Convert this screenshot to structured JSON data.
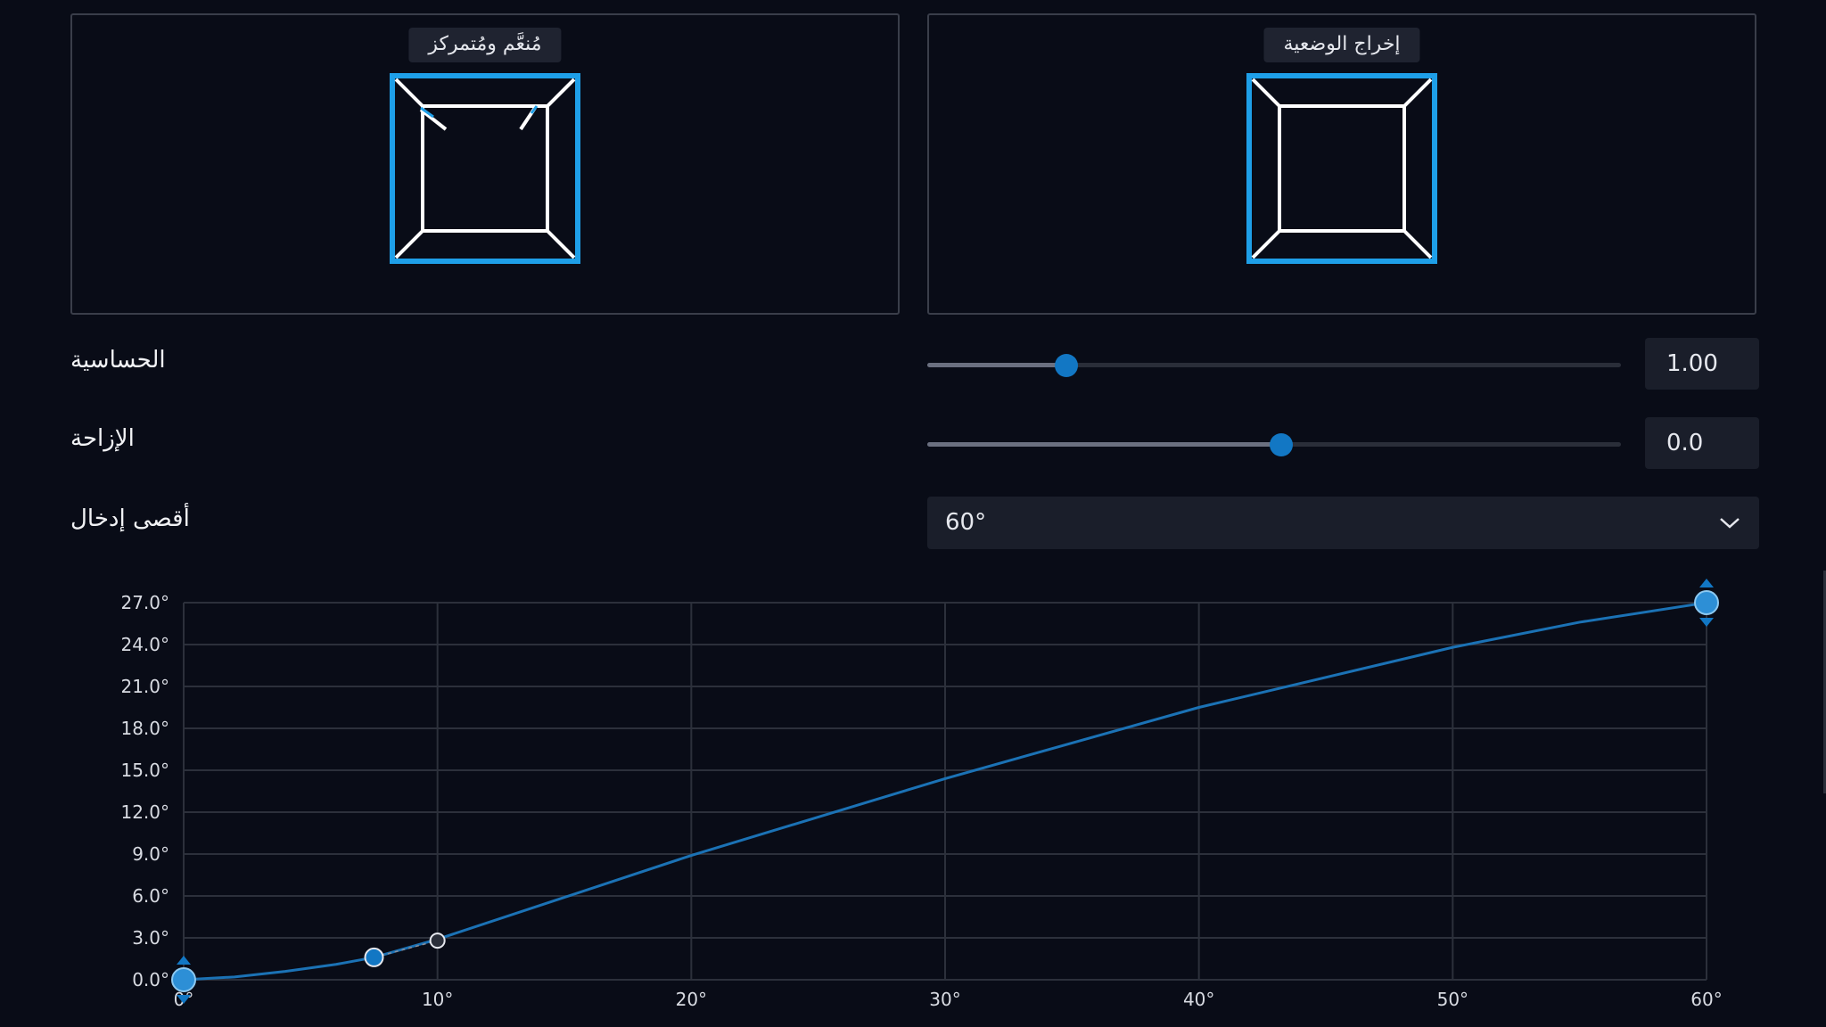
{
  "preview_panels": [
    {
      "title": "مُنعَّم ومُتمركز"
    },
    {
      "title": "إخراج الوضعية"
    }
  ],
  "sensitivity": {
    "label": "الحساسية",
    "value": "1.00",
    "fraction": 0.2
  },
  "offset": {
    "label": "الإزاحة",
    "value": "0.0",
    "fraction": 0.51
  },
  "max_input": {
    "label": "أقصى إدخال",
    "selected": "60°"
  },
  "colors": {
    "accent": "#1e9fe8",
    "curve": "#1b72b5",
    "thumb": "#1277c4"
  },
  "chart_data": {
    "type": "line",
    "x_ticks": [
      "0°",
      "10°",
      "20°",
      "30°",
      "40°",
      "50°",
      "60°"
    ],
    "y_ticks": [
      "0.0°",
      "3.0°",
      "6.0°",
      "9.0°",
      "12.0°",
      "15.0°",
      "18.0°",
      "21.0°",
      "24.0°",
      "27.0°"
    ],
    "xlim": [
      0,
      60
    ],
    "ylim": [
      0,
      27
    ],
    "grid": true,
    "curve": {
      "x": [
        0,
        2,
        4,
        6,
        7.5,
        10,
        15,
        20,
        30,
        40,
        50,
        55,
        60
      ],
      "y": [
        0,
        0.2,
        0.6,
        1.1,
        1.6,
        2.9,
        5.9,
        8.9,
        14.4,
        19.5,
        23.8,
        25.6,
        27
      ]
    },
    "control_points": [
      {
        "x": 0,
        "y": 0,
        "kind": "endpoint"
      },
      {
        "x": 7.5,
        "y": 1.6,
        "kind": "handle"
      },
      {
        "x": 10,
        "y": 2.8,
        "kind": "point"
      },
      {
        "x": 60,
        "y": 27,
        "kind": "endpoint"
      }
    ]
  }
}
